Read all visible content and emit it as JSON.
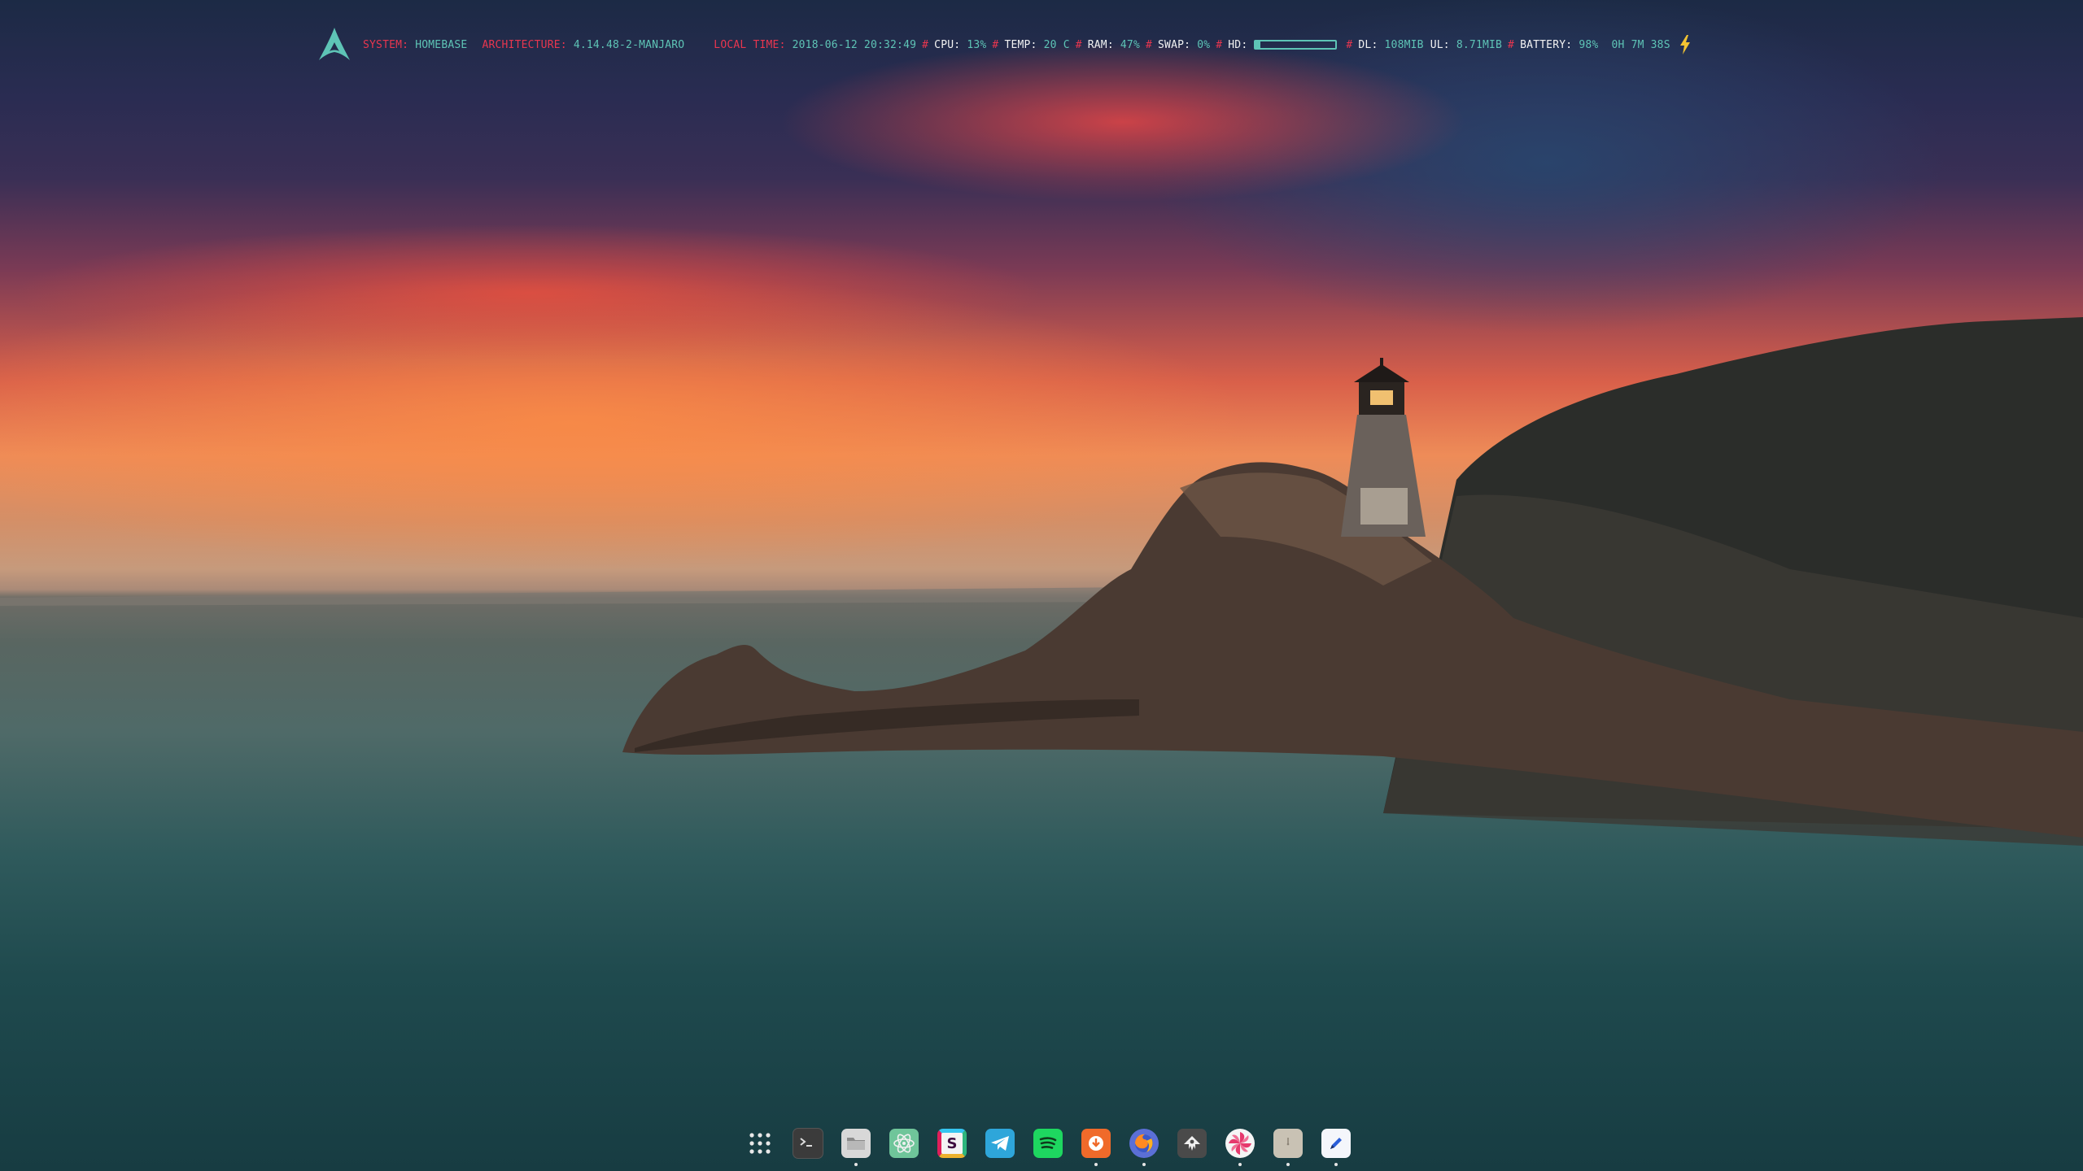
{
  "status_bar": {
    "system_label": "SYSTEM:",
    "system_value": "HOMEBASE",
    "arch_label": "ARCHITECTURE:",
    "arch_value": "4.14.48-2-MANJARO",
    "time_label": "LOCAL TIME:",
    "time_value": "2018-06-12 20:32:49",
    "separator": "#",
    "cpu_label": "CPU:",
    "cpu_value": "13%",
    "temp_label": "TEMP:",
    "temp_value": "20 C",
    "ram_label": "RAM:",
    "ram_value": "47%",
    "swap_label": "SWAP:",
    "swap_value": "0%",
    "hd_label": "HD:",
    "hd_usage_fraction": 0.06,
    "dl_label": "DL:",
    "dl_value": "108MIB",
    "ul_label": "UL:",
    "ul_value": "8.71MIB",
    "battery_label": "BATTERY:",
    "battery_value": "98%",
    "battery_time": "0H 7M 38S",
    "colors": {
      "label_red": "#e8364f",
      "value_teal": "#5ec4b6",
      "label_white": "#f2f2f2",
      "bolt": "#f3c432"
    },
    "icons": {
      "logo": "arch-logo-icon",
      "charging": "lightning-bolt-icon"
    }
  },
  "dock": {
    "items": [
      {
        "name": "app-grid",
        "icon": "app-grid-icon",
        "running": false
      },
      {
        "name": "terminal",
        "icon": "terminal-icon",
        "running": false
      },
      {
        "name": "files",
        "icon": "folder-icon",
        "running": true
      },
      {
        "name": "atom",
        "icon": "atom-icon",
        "running": false
      },
      {
        "name": "slack",
        "icon": "slack-icon",
        "running": false
      },
      {
        "name": "telegram",
        "icon": "telegram-icon",
        "running": false
      },
      {
        "name": "spotify",
        "icon": "spotify-icon",
        "running": false
      },
      {
        "name": "software",
        "icon": "software-center-icon",
        "running": true
      },
      {
        "name": "firefox",
        "icon": "firefox-icon",
        "running": true
      },
      {
        "name": "inkscape",
        "icon": "inkscape-icon",
        "running": false
      },
      {
        "name": "insomnia",
        "icon": "pinwheel-icon",
        "running": true
      },
      {
        "name": "clock",
        "icon": "clock-icon",
        "running": true
      },
      {
        "name": "text-editor",
        "icon": "pencil-icon",
        "running": true
      }
    ]
  }
}
